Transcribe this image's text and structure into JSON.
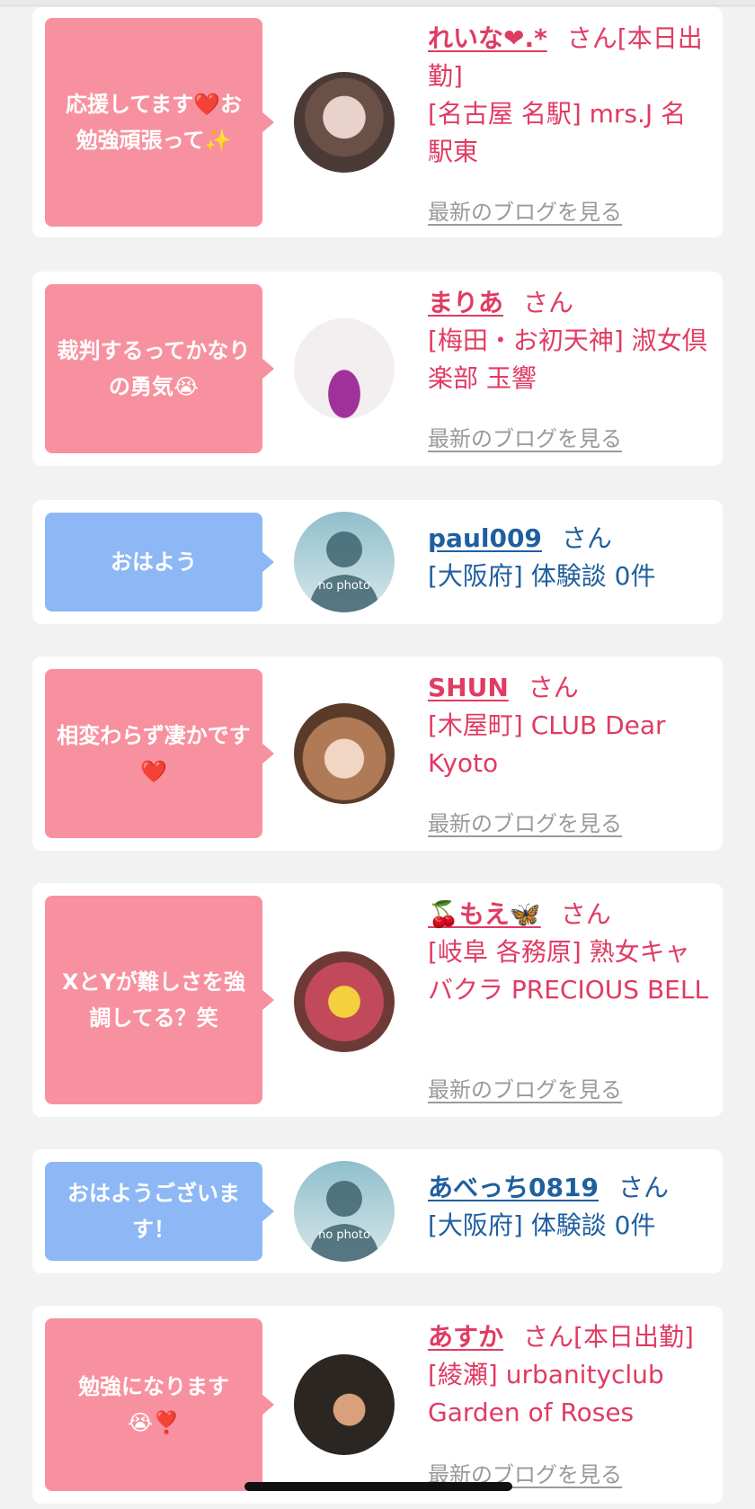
{
  "comments": [
    {
      "message": "応援してます❤️お勉強頑張って✨",
      "name": "れいな❤.*",
      "honorific": "さん",
      "suffix": "[本日出勤]",
      "location": "[名古屋 名駅] mrs.J 名駅東",
      "blog_link": "最新のブログを見る",
      "theme": "pink",
      "avatar": "woman-photo"
    },
    {
      "message": "裁判するってかなりの勇気😭",
      "name": "まりあ",
      "honorific": "さん",
      "suffix": "",
      "location": "[梅田・お初天神] 淑女倶楽部 玉響",
      "blog_link": "最新のブログを見る",
      "theme": "pink",
      "avatar": "woman-dress-photo"
    },
    {
      "message": "おはよう",
      "name": "paul009",
      "honorific": "さん",
      "suffix": "",
      "location": "[大阪府] 体験談 0件",
      "blog_link": "",
      "theme": "blue",
      "avatar": "no-photo",
      "avatar_text": "no photo"
    },
    {
      "message": "相変わらず凄かです❤️",
      "name": "SHUN",
      "honorific": "さん",
      "suffix": "",
      "location": "[木屋町] CLUB Dear Kyoto",
      "blog_link": "最新のブログを見る",
      "theme": "pink",
      "avatar": "woman-photo"
    },
    {
      "message": "XとYが難しさを強調してる？笑",
      "name": "🍒もえ🦋",
      "honorific": "さん",
      "suffix": "",
      "location": "[岐阜 各務原]  熟女キャバクラ PRECIOUS BELL",
      "blog_link": "最新のブログを見る",
      "theme": "pink",
      "avatar": "smiley-covered-photo"
    },
    {
      "message": "おはようございます！",
      "name": "あべっち0819",
      "honorific": "さん",
      "suffix": "",
      "location": "[大阪府] 体験談 0件",
      "blog_link": "",
      "theme": "blue",
      "avatar": "no-photo",
      "avatar_text": "no photo"
    },
    {
      "message": "勉強になります😭❣️",
      "name": "あすか",
      "honorific": "さん",
      "suffix": "[本日出勤]",
      "location": "[綾瀬] urbanityclub Garden of Roses",
      "blog_link": "最新のブログを見る",
      "theme": "pink",
      "avatar": "woman-sofa-photo"
    }
  ]
}
